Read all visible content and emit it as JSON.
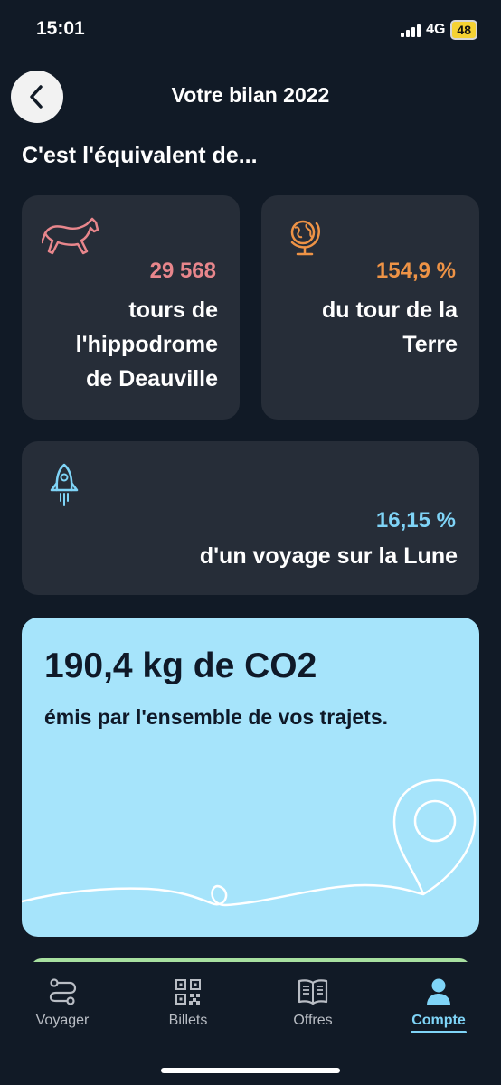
{
  "status_bar": {
    "time": "15:01",
    "network": "4G",
    "battery": "48"
  },
  "header": {
    "title": "Votre bilan 2022"
  },
  "section": {
    "heading": "C'est l'équivalent de..."
  },
  "cards": {
    "horse": {
      "icon": "horse-icon",
      "value": "29 568",
      "text": [
        "tours de",
        "l'hippodrome",
        "de Deauville"
      ],
      "accent": "#e8868c"
    },
    "globe": {
      "icon": "globe-icon",
      "value": "154,9 %",
      "text": [
        "du tour de la",
        "Terre"
      ],
      "accent": "#ee9346"
    },
    "rocket": {
      "icon": "rocket-icon",
      "value": "16,15 %",
      "text": [
        "d'un voyage sur la Lune"
      ],
      "accent": "#7fd4f7"
    }
  },
  "co2": {
    "title": "190,4 kg de CO2",
    "text": "émis par l'ensemble de vos trajets.",
    "background": "#a6e4fb",
    "decoration_icon": "location-pin-icon"
  },
  "bottom_nav": {
    "items": [
      {
        "label": "Voyager",
        "icon": "route-icon",
        "active": false
      },
      {
        "label": "Billets",
        "icon": "qr-code-icon",
        "active": false
      },
      {
        "label": "Offres",
        "icon": "book-icon",
        "active": false
      },
      {
        "label": "Compte",
        "icon": "user-icon",
        "active": true
      }
    ],
    "active_color": "#7fd4f7"
  }
}
